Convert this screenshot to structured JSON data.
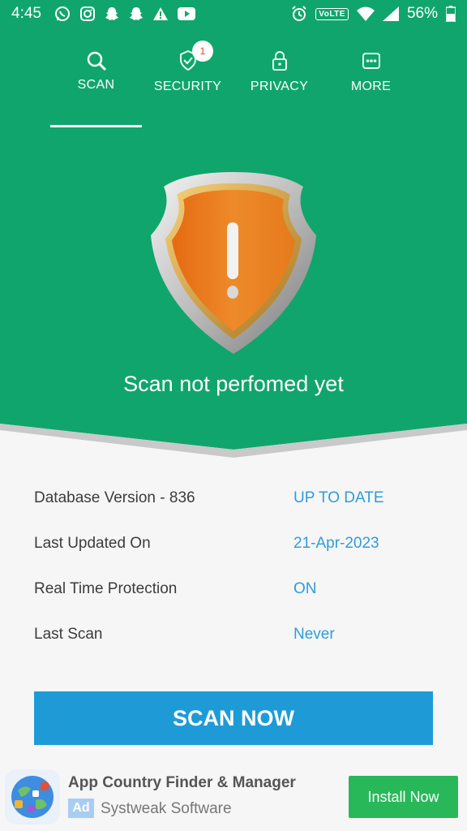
{
  "status_bar": {
    "time": "4:45",
    "volte": "VoLTE",
    "battery": "56%",
    "left_icons": [
      "whatsapp-icon",
      "instagram-icon",
      "snapchat-icon",
      "snapchat-icon",
      "warning-icon",
      "youtube-icon"
    ],
    "right_icons": [
      "alarm-icon",
      "volte-icon",
      "wifi-icon",
      "signal-icon",
      "battery-icon"
    ]
  },
  "tabs": [
    {
      "label": "SCAN",
      "icon": "search-icon",
      "active": true
    },
    {
      "label": "SECURITY",
      "icon": "shield-check-icon",
      "badge": "1"
    },
    {
      "label": "PRIVACY",
      "icon": "lock-icon"
    },
    {
      "label": "MORE",
      "icon": "more-icon"
    }
  ],
  "scan_status": "Scan not perfomed yet",
  "info_rows": [
    {
      "label": "Database Version - 836",
      "value": "UP TO DATE"
    },
    {
      "label": "Last Updated On",
      "value": "21-Apr-2023"
    },
    {
      "label": "Real Time Protection",
      "value": "ON"
    },
    {
      "label": "Last Scan",
      "value": "Never"
    }
  ],
  "scan_button": "SCAN NOW",
  "ad": {
    "title": "App Country Finder & Manager",
    "tag": "Ad",
    "subtitle": "Systweak Software",
    "install": "Install Now"
  },
  "colors": {
    "header_green": "#10a56c",
    "accent_blue": "#1e9bd7",
    "value_blue": "#2e9ddb",
    "install_green": "#28b85a",
    "shield_orange": "#e8771c"
  }
}
